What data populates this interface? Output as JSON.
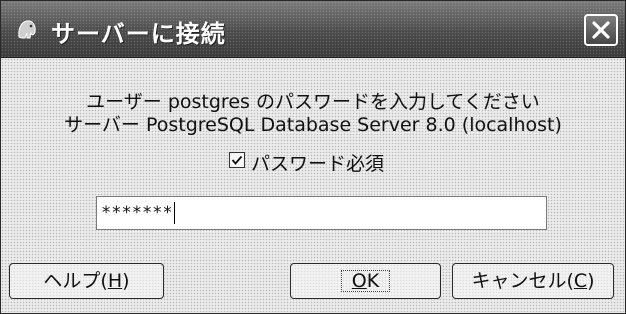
{
  "window": {
    "title": "サーバーに接続",
    "icon": "elephant-app-icon",
    "close_icon": "close-icon"
  },
  "message": {
    "line1": "ユーザー postgres のパスワードを入力してください",
    "line2": "サーバー PostgreSQL Database Server 8.0 (localhost)"
  },
  "checkbox": {
    "label": "パスワード必須",
    "checked": true
  },
  "password": {
    "value": "*******"
  },
  "buttons": {
    "help_prefix": "ヘルプ(",
    "help_key": "H",
    "help_suffix": ")",
    "ok_key": "O",
    "ok_rest": "K",
    "cancel_prefix": "キャンセル(",
    "cancel_key": "C",
    "cancel_suffix": ")"
  },
  "colors": {
    "titlebar": "#5a5a5a",
    "window_bg": "#ececec",
    "text": "#111111"
  }
}
